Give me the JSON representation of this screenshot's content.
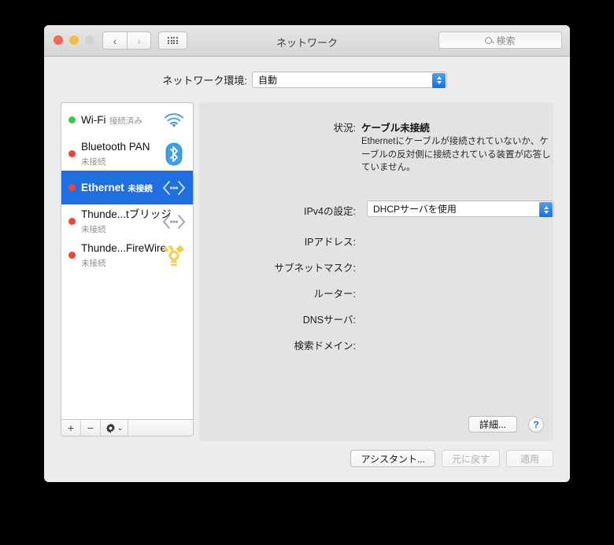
{
  "titlebar": {
    "title": "ネットワーク",
    "traffic": {
      "close": "close-button",
      "minimize": "minimize-button",
      "zoom": "zoom-button"
    },
    "back_glyph": "‹",
    "forward_glyph": "›",
    "grid_icon": "grid-view-icon",
    "search": {
      "placeholder": "検索",
      "value": "",
      "icon": "search-icon"
    }
  },
  "location": {
    "label": "ネットワーク環境:",
    "selected": "自動",
    "options": [
      "自動"
    ]
  },
  "sidebar": {
    "items": [
      {
        "name": "Wi-Fi",
        "status": "接続済み",
        "dot": "green",
        "icon": "wifi-icon",
        "selected": false
      },
      {
        "name": "Bluetooth PAN",
        "status": "未接続",
        "dot": "red",
        "icon": "bluetooth-icon",
        "selected": false
      },
      {
        "name": "Ethernet",
        "status": "未接続",
        "dot": "red",
        "icon": "ethernet-icon",
        "selected": true
      },
      {
        "name": "Thunde...tブリッジ",
        "status": "未接続",
        "dot": "red",
        "icon": "ethernet-icon",
        "selected": false
      },
      {
        "name": "Thunde...FireWire",
        "status": "未接続",
        "dot": "red",
        "icon": "firewire-icon",
        "selected": false
      }
    ],
    "toolbar": {
      "add_label": "+",
      "remove_label": "−",
      "gear_label": "gear-icon",
      "gear_chevron": "⌄"
    }
  },
  "main": {
    "status_label": "状況:",
    "status_value": "ケーブル未接続",
    "status_description": "Ethernetにケーブルが接続されていないか、ケーブルの反対側に接続されている装置が応答していません。",
    "fields": [
      {
        "label": "IPv4の設定:",
        "value": "DHCPサーバを使用",
        "type": "select"
      },
      {
        "label": "IPアドレス:",
        "value": "",
        "type": "text"
      },
      {
        "label": "サブネットマスク:",
        "value": "",
        "type": "text"
      },
      {
        "label": "ルーター:",
        "value": "",
        "type": "text"
      },
      {
        "label": "DNSサーバ:",
        "value": "",
        "type": "text"
      },
      {
        "label": "検索ドメイン:",
        "value": "",
        "type": "text"
      }
    ],
    "advanced_label": "詳細...",
    "help_label": "?"
  },
  "footer": {
    "assistant_label": "アシスタント...",
    "revert_label": "元に戻す",
    "apply_label": "適用",
    "revert_disabled": true,
    "apply_disabled": true
  },
  "colors": {
    "selection_blue": "#1f6fe0",
    "connected_green": "#3cc84b",
    "disconnected_red": "#f44336",
    "accent_link": "#2f6fd0",
    "window_bg": "#ececec",
    "panel_bg": "#e3e3e3"
  }
}
